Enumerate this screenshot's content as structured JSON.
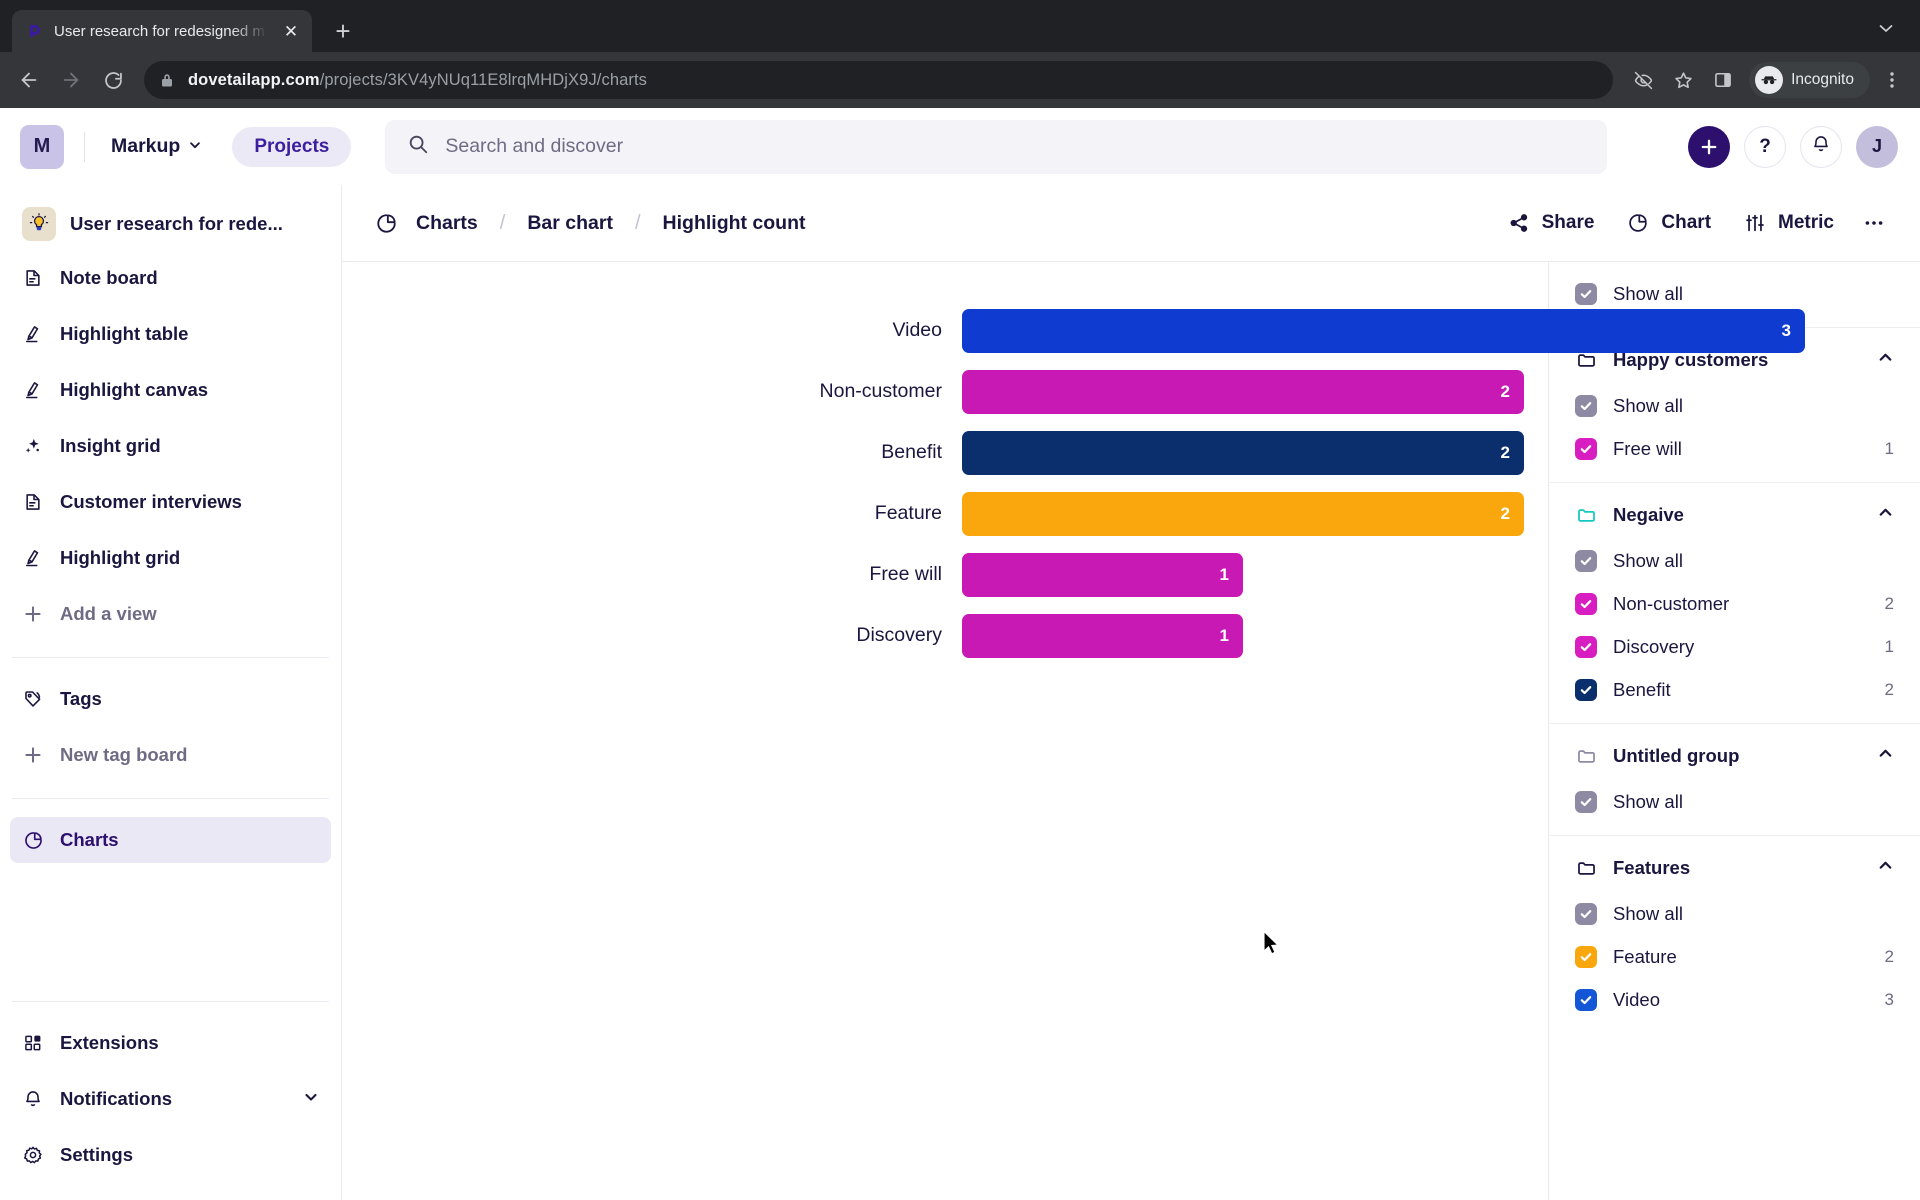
{
  "browser": {
    "tab_title": "User research for redesigned m",
    "tab_favicon_name": "dovetail-favicon",
    "new_tab_label": "+",
    "close_label": "✕",
    "url_domain": "dovetailapp.com",
    "url_path": "/projects/3KV4yNUq11E8lrqMHDjX9J/charts",
    "incognito_label": "Incognito",
    "back_icon": "back-arrow-icon",
    "forward_icon": "forward-arrow-icon",
    "reload_icon": "reload-icon",
    "lock_icon": "lock-icon",
    "eye_off_icon": "eye-off-icon",
    "star_icon": "star-icon",
    "side_panel_icon": "side-panel-icon",
    "menu_icon": "kebab-menu-icon"
  },
  "header": {
    "workspace_initial": "M",
    "workspace_name": "Markup",
    "projects_label": "Projects",
    "search_placeholder": "Search and discover",
    "add_label": "+",
    "help_label": "?",
    "user_initial": "J"
  },
  "sidebar": {
    "project_title": "User research for rede...",
    "items": [
      {
        "label": "Note board",
        "icon": "note-board-icon"
      },
      {
        "label": "Highlight table",
        "icon": "highlighter-icon"
      },
      {
        "label": "Highlight canvas",
        "icon": "highlighter-icon"
      },
      {
        "label": "Insight grid",
        "icon": "sparkle-icon"
      },
      {
        "label": "Customer interviews",
        "icon": "note-board-icon"
      },
      {
        "label": "Highlight grid",
        "icon": "highlighter-icon"
      },
      {
        "label": "Add a view",
        "icon": "plus-icon"
      }
    ],
    "tags_label": "Tags",
    "new_tag_board_label": "New tag board",
    "charts_label": "Charts",
    "extensions_label": "Extensions",
    "notifications_label": "Notifications",
    "settings_label": "Settings"
  },
  "main": {
    "breadcrumb": [
      "Charts",
      "Bar chart",
      "Highlight count"
    ],
    "breadcrumb_separator": "/",
    "toolbar": {
      "share_label": "Share",
      "chart_label": "Chart",
      "metric_label": "Metric",
      "more_label": "•••"
    }
  },
  "chart_data": {
    "type": "bar",
    "orientation": "horizontal",
    "title": "Highlight count",
    "xlabel": "",
    "ylabel": "",
    "categories": [
      "Video",
      "Non-customer",
      "Benefit",
      "Feature",
      "Free will",
      "Discovery"
    ],
    "values": [
      3,
      2,
      2,
      2,
      1,
      1
    ],
    "colors": [
      "#0f3bd1",
      "#c919b4",
      "#0b2f6d",
      "#f9a70c",
      "#c919b4",
      "#c919b4"
    ],
    "xlim": [
      0,
      3.5
    ],
    "grid": false,
    "legend": "none",
    "data_labels": [
      "3",
      "2",
      "2",
      "2",
      "1",
      "1"
    ]
  },
  "right_panel": {
    "show_all_top": "Show all",
    "groups": [
      {
        "name": "Happy customers",
        "folder_color": "#1b163f",
        "collapse_icon": "chevron-up-icon",
        "show_all": "Show all",
        "items": [
          {
            "label": "Free will",
            "count": "1",
            "color": "#d81ec0",
            "checked": true
          }
        ]
      },
      {
        "name": "Negaive",
        "folder_color": "#12c8c0",
        "collapse_icon": "chevron-up-icon",
        "show_all": "Show all",
        "items": [
          {
            "label": "Non-customer",
            "count": "2",
            "color": "#d81ec0",
            "checked": true
          },
          {
            "label": "Discovery",
            "count": "1",
            "color": "#d81ec0",
            "checked": true
          },
          {
            "label": "Benefit",
            "count": "2",
            "color": "#0b2f6d",
            "checked": true
          }
        ]
      },
      {
        "name": "Untitled group",
        "folder_color": "#8e8aa3",
        "collapse_icon": "chevron-up-icon",
        "show_all": "Show all",
        "items": []
      },
      {
        "name": "Features",
        "folder_color": "#1b163f",
        "collapse_icon": "chevron-up-icon",
        "show_all": "Show all",
        "items": [
          {
            "label": "Feature",
            "count": "2",
            "color": "#f9a70c",
            "checked": true
          },
          {
            "label": "Video",
            "count": "3",
            "color": "#1457d6",
            "checked": true
          }
        ]
      }
    ],
    "show_all_color": "#8e8aa3"
  }
}
